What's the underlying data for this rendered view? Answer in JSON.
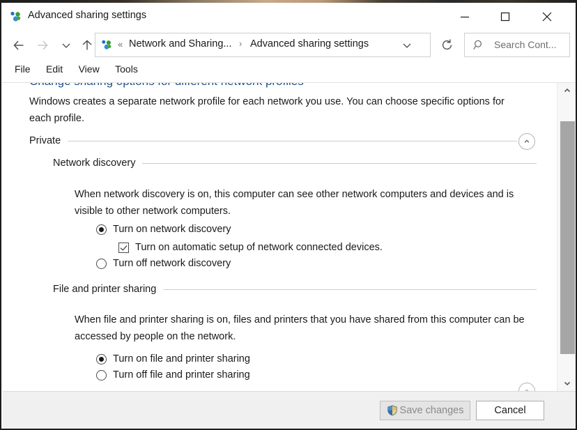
{
  "window": {
    "title": "Advanced sharing settings",
    "icon": "network-sharing-icon",
    "controls": {
      "minimize": "Minimize",
      "maximize": "Maximize",
      "close": "Close"
    }
  },
  "navbar": {
    "back": "Back",
    "forward": "Forward",
    "recent": "Recent locations",
    "up": "Up",
    "breadcrumb": {
      "icon": "network-sharing-icon",
      "overflow": "«",
      "item1": "Network and Sharing...",
      "separator": "›",
      "item2": "Advanced sharing settings"
    },
    "dropdown": "Previous locations",
    "refresh": "Refresh"
  },
  "search": {
    "icon": "search-icon",
    "placeholder": "Search Cont...",
    "value": ""
  },
  "menubar": {
    "items": [
      {
        "label": "File"
      },
      {
        "label": "Edit"
      },
      {
        "label": "View"
      },
      {
        "label": "Tools"
      }
    ]
  },
  "content": {
    "clipped_heading": "Change sharing options for different network profiles",
    "intro": "Windows creates a separate network profile for each network you use. You can choose specific options for each profile.",
    "profile": {
      "label": "Private",
      "collapse_button": "Collapse Private"
    },
    "network_discovery": {
      "heading": "Network discovery",
      "description": "When network discovery is on, this computer can see other network computers and devices and is visible to other network computers.",
      "options": [
        {
          "label": "Turn on network discovery",
          "selected": true
        },
        {
          "label": "Turn off network discovery",
          "selected": false
        }
      ],
      "checkbox": {
        "label": "Turn on automatic setup of network connected devices.",
        "checked": true
      }
    },
    "file_printer_sharing": {
      "heading": "File and printer sharing",
      "description": "When file and printer sharing is on, files and printers that you have shared from this computer can be accessed by people on the network.",
      "options": [
        {
          "label": "Turn on file and printer sharing",
          "selected": true
        },
        {
          "label": "Turn off file and printer sharing",
          "selected": false
        }
      ]
    },
    "bottom_collapse_button": "Collapse section"
  },
  "scrollbar": {
    "up_arrow": "Scroll up",
    "down_arrow": "Scroll down",
    "thumb": "Vertical scroll thumb"
  },
  "footer": {
    "save": {
      "label": "Save changes",
      "icon": "uac-shield-icon",
      "disabled": true
    },
    "cancel": {
      "label": "Cancel",
      "disabled": false
    }
  },
  "colors": {
    "window_bg": "#ffffff",
    "footer_bg": "#f0f0f0",
    "heading_blue": "#1f4e8c",
    "text": "#1a1a1a",
    "rule": "#cdcdcd",
    "scroll_thumb": "#a6a6a6",
    "disabled_text": "#8a8a8a"
  }
}
